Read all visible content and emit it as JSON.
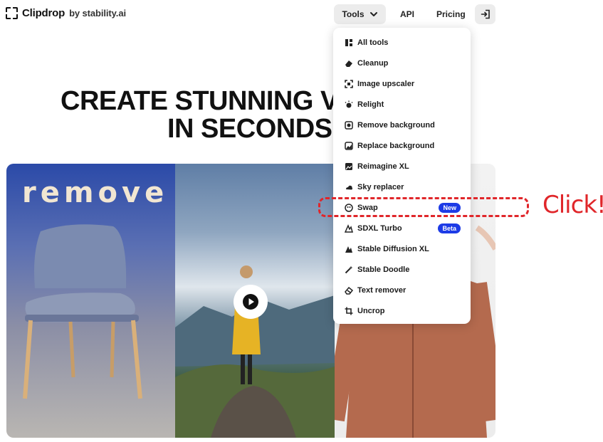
{
  "header": {
    "brand": "Clipdrop",
    "brand_by": "by stability.ai",
    "nav": {
      "tools_label": "Tools",
      "api_label": "API",
      "pricing_label": "Pricing"
    }
  },
  "hero": {
    "title_line1": "CREATE STUNNING V",
    "title_line2": "IN SECONDS"
  },
  "media": {
    "overlay_word": "remove"
  },
  "tools_menu": {
    "items": [
      {
        "label": "All tools",
        "icon": "all-tools-icon"
      },
      {
        "label": "Cleanup",
        "icon": "eraser-icon"
      },
      {
        "label": "Image upscaler",
        "icon": "upscale-icon"
      },
      {
        "label": "Relight",
        "icon": "relight-icon"
      },
      {
        "label": "Remove background",
        "icon": "remove-bg-icon"
      },
      {
        "label": "Replace background",
        "icon": "replace-bg-icon"
      },
      {
        "label": "Reimagine XL",
        "icon": "reimagine-icon"
      },
      {
        "label": "Sky replacer",
        "icon": "sky-icon"
      },
      {
        "label": "Swap",
        "icon": "swap-icon",
        "badge": "New"
      },
      {
        "label": "SDXL Turbo",
        "icon": "turbo-icon",
        "badge": "Beta"
      },
      {
        "label": "Stable Diffusion XL",
        "icon": "diffusion-icon"
      },
      {
        "label": "Stable Doodle",
        "icon": "wand-icon"
      },
      {
        "label": "Text remover",
        "icon": "text-remover-icon"
      },
      {
        "label": "Uncrop",
        "icon": "crop-icon"
      }
    ]
  },
  "annotation": {
    "text": "Click!",
    "color": "#e0262a"
  },
  "colors": {
    "badge_blue": "#1d3be6",
    "nav_pill": "#ececec"
  }
}
